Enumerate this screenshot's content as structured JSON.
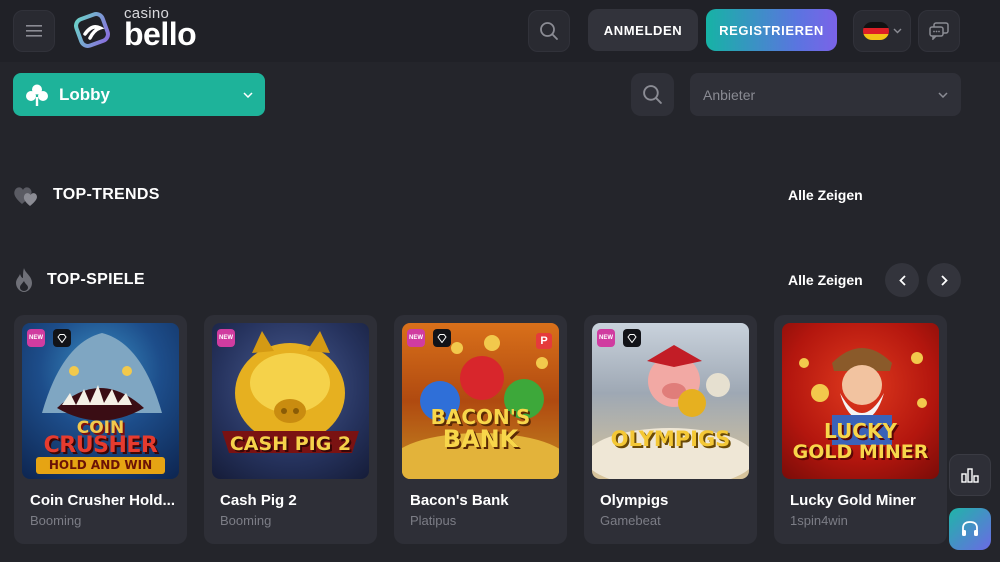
{
  "header": {
    "logo": {
      "small": "casino",
      "big": "bello"
    },
    "login_label": "ANMELDEN",
    "register_label": "REGISTRIEREN",
    "language": "de"
  },
  "filters": {
    "category_label": "Lobby",
    "provider_placeholder": "Anbieter"
  },
  "sections": {
    "trends": {
      "title": "TOP-TRENDS",
      "show_all": "Alle Zeigen"
    },
    "games": {
      "title": "TOP-SPIELE",
      "show_all": "Alle Zeigen"
    }
  },
  "games": [
    {
      "name": "Coin Crusher Hold...",
      "provider": "Booming",
      "art_title_1": "COIN",
      "art_title_2": "CRUSHER",
      "art_title_3": "HOLD AND WIN",
      "badges": [
        "new",
        "diamond"
      ]
    },
    {
      "name": "Cash Pig 2",
      "provider": "Booming",
      "art_title_1": "CASH PIG 2",
      "badges": [
        "new"
      ]
    },
    {
      "name": "Bacon's Bank",
      "provider": "Platipus",
      "art_title_1": "BACON'S",
      "art_title_2": "BANK",
      "art_badge": "P",
      "badges": [
        "new",
        "diamond"
      ]
    },
    {
      "name": "Olympigs",
      "provider": "Gamebeat",
      "art_title_1": "OLYMPIGS",
      "badges": [
        "new",
        "diamond"
      ]
    },
    {
      "name": "Lucky Gold Miner",
      "provider": "1spin4win",
      "art_title_1": "LUCKY",
      "art_title_2": "GOLD MINER",
      "badges": []
    }
  ],
  "badge_new_label": "NEW",
  "colors": {
    "background": "#24252b",
    "accent": "#1eb39a",
    "register_gradient_start": "#16b3a5",
    "register_gradient_end": "#7b63e8"
  },
  "icons": {
    "menu": "hamburger-icon",
    "search": "search-icon",
    "chat": "chat-icon",
    "lobby": "clover-icon",
    "trends": "hearts-icon",
    "games": "flame-icon",
    "stats": "bar-chart-icon",
    "support": "headset-icon"
  }
}
